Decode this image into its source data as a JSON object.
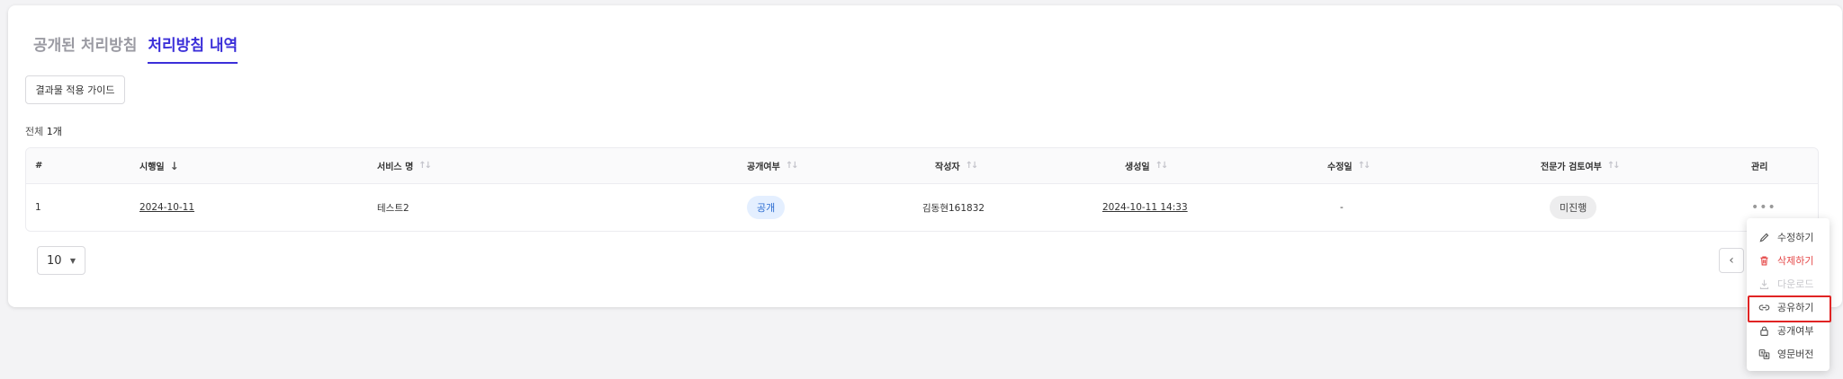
{
  "tabs": [
    {
      "label": "공개된 처리방침"
    },
    {
      "label": "처리방침 내역"
    }
  ],
  "guide_button": "결과물 적용 가이드",
  "total": {
    "prefix": "전체",
    "count": "1개"
  },
  "table": {
    "headers": [
      "#",
      "시행일",
      "서비스 명",
      "공개여부",
      "작성자",
      "생성일",
      "수정일",
      "전문가 검토여부",
      "관리"
    ],
    "rows": [
      {
        "no": "1",
        "effective_date": "2024-10-11",
        "service": "테스트2",
        "public": "공개",
        "author": "김동현161832",
        "created": "2024-10-11 14:33",
        "modified": "-",
        "review": "미진행",
        "manage": "•••"
      }
    ]
  },
  "page_size": "10",
  "context_menu": [
    {
      "label": "수정하기",
      "icon": "pencil-icon"
    },
    {
      "label": "삭제하기",
      "icon": "trash-icon"
    },
    {
      "label": "다운로드",
      "icon": "download-icon"
    },
    {
      "label": "공유하기",
      "icon": "link-icon"
    },
    {
      "label": "공개여부",
      "icon": "lock-icon"
    },
    {
      "label": "영문버전",
      "icon": "translate-icon"
    }
  ],
  "colors": {
    "accent": "#3b2fd9",
    "danger": "#e54848",
    "highlight": "#e02424"
  }
}
